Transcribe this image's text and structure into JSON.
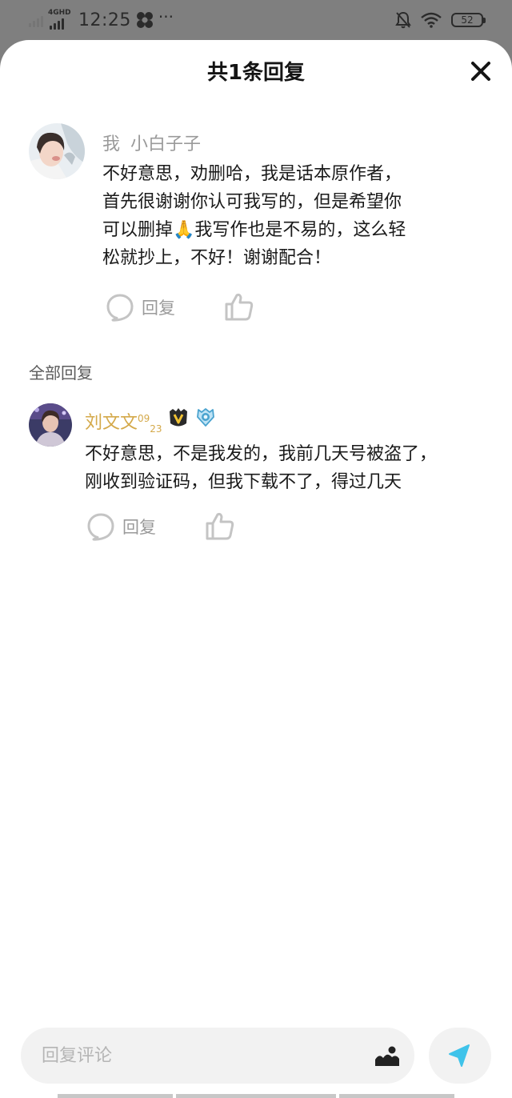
{
  "status_bar": {
    "network_type": "4GHD",
    "time": "12:25",
    "more": "···",
    "battery": "52"
  },
  "header": {
    "title": "共1条回复"
  },
  "main_comment": {
    "author_prefix": "我",
    "author_name": "小白子子",
    "lines": [
      "不好意思，劝删哈，我是话本原作者，",
      "首先很谢谢你认可我写的，但是希望你",
      "可以删掉🙏我写作也是不易的，这么轻",
      "松就抄上，不好！谢谢配合！"
    ],
    "reply_label": "回复"
  },
  "replies_section": {
    "label": "全部回复"
  },
  "replies": [
    {
      "author": "刘文文",
      "sup": "09",
      "sub": "23",
      "lines": [
        "不好意思，不是我发的，我前几天号被盗了，",
        "刚收到验证码，但我下载不了，得过几天"
      ],
      "reply_label": "回复"
    }
  ],
  "composer": {
    "placeholder": "回复评论"
  },
  "colors": {
    "username_gold": "#d4a94a",
    "send_blue": "#3fc3ea",
    "gray_text": "#9a9a9a"
  },
  "icons": {
    "close": "close-icon",
    "comment": "comment-bubble-icon",
    "like": "thumbs-up-icon",
    "image": "image-icon",
    "send": "send-icon"
  }
}
